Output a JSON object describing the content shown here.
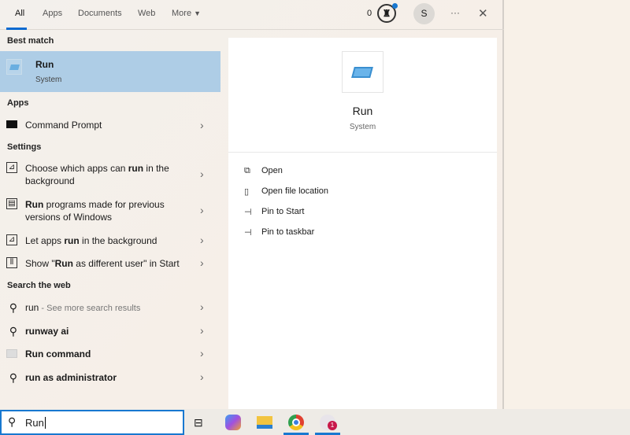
{
  "tabs": [
    {
      "label": "All",
      "active": true
    },
    {
      "label": "Apps"
    },
    {
      "label": "Documents"
    },
    {
      "label": "Web"
    },
    {
      "label": "More"
    }
  ],
  "header": {
    "points": "0",
    "avatar_letter": "S",
    "more_label": "···",
    "close_label": "✕"
  },
  "best_match": {
    "heading": "Best match",
    "title": "Run",
    "subtitle": "System"
  },
  "apps": {
    "heading": "Apps",
    "items": [
      {
        "label": "Command Prompt"
      }
    ]
  },
  "settings": {
    "heading": "Settings",
    "items": [
      {
        "pre": "Choose which apps can ",
        "bold": "run",
        "post": " in the background"
      },
      {
        "pre": "",
        "bold": "Run",
        "post": " programs made for previous versions of Windows"
      },
      {
        "pre": "Let apps ",
        "bold": "run",
        "post": " in the background"
      },
      {
        "pre": "Show \"",
        "bold": "Run",
        "post": " as different user\" in Start"
      }
    ]
  },
  "web": {
    "heading": "Search the web",
    "items": [
      {
        "label": "run",
        "suffix": " - See more search results",
        "icon": "search-icon"
      },
      {
        "label": "runway ai",
        "icon": "search-icon"
      },
      {
        "label": "Run command",
        "icon": "run-command-icon"
      },
      {
        "label": "run as administrator",
        "icon": "search-icon"
      }
    ]
  },
  "preview": {
    "title": "Run",
    "subtitle": "System",
    "actions": [
      {
        "label": "Open",
        "icon": "open-icon"
      },
      {
        "label": "Open file location",
        "icon": "folder-icon"
      },
      {
        "label": "Pin to Start",
        "icon": "pin-icon"
      },
      {
        "label": "Pin to taskbar",
        "icon": "pin-icon"
      }
    ]
  },
  "search": {
    "value": "Run"
  },
  "taskbar": {
    "badge": "1"
  },
  "colors": {
    "accent": "#1878d0",
    "selected": "#aecde6"
  }
}
